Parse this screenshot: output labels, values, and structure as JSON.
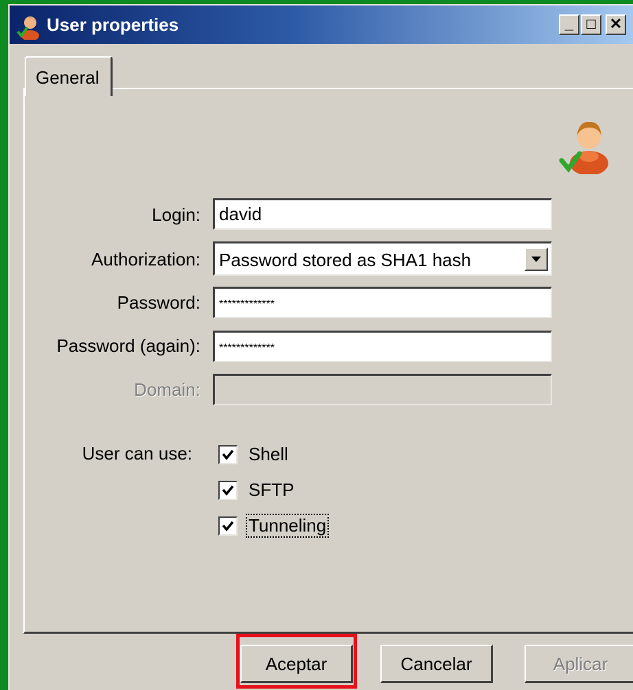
{
  "window": {
    "title": "User properties",
    "icon": "user-icon",
    "controls": {
      "minimize": "_",
      "maximize": "□",
      "close": "✕"
    }
  },
  "tabs": [
    {
      "label": "General",
      "active": true
    }
  ],
  "form": {
    "login": {
      "label": "Login:",
      "value": "david"
    },
    "authorization": {
      "label": "Authorization:",
      "value": "Password stored as SHA1 hash"
    },
    "password": {
      "label": "Password:",
      "value": "*************"
    },
    "password_again": {
      "label": "Password (again):",
      "value": "*************"
    },
    "domain": {
      "label": "Domain:",
      "value": "",
      "disabled": true
    },
    "user_can_use": {
      "label": "User can use:",
      "options": [
        {
          "label": "Shell",
          "checked": true
        },
        {
          "label": "SFTP",
          "checked": true
        },
        {
          "label": "Tunneling",
          "checked": true,
          "focused": true
        }
      ]
    }
  },
  "buttons": {
    "accept": "Aceptar",
    "cancel": "Cancelar",
    "apply": "Aplicar"
  },
  "colors": {
    "desktop": "#0e8a22",
    "highlight": "#e8101a",
    "titlebar_start": "#0a246a",
    "titlebar_end": "#a6caf0"
  }
}
